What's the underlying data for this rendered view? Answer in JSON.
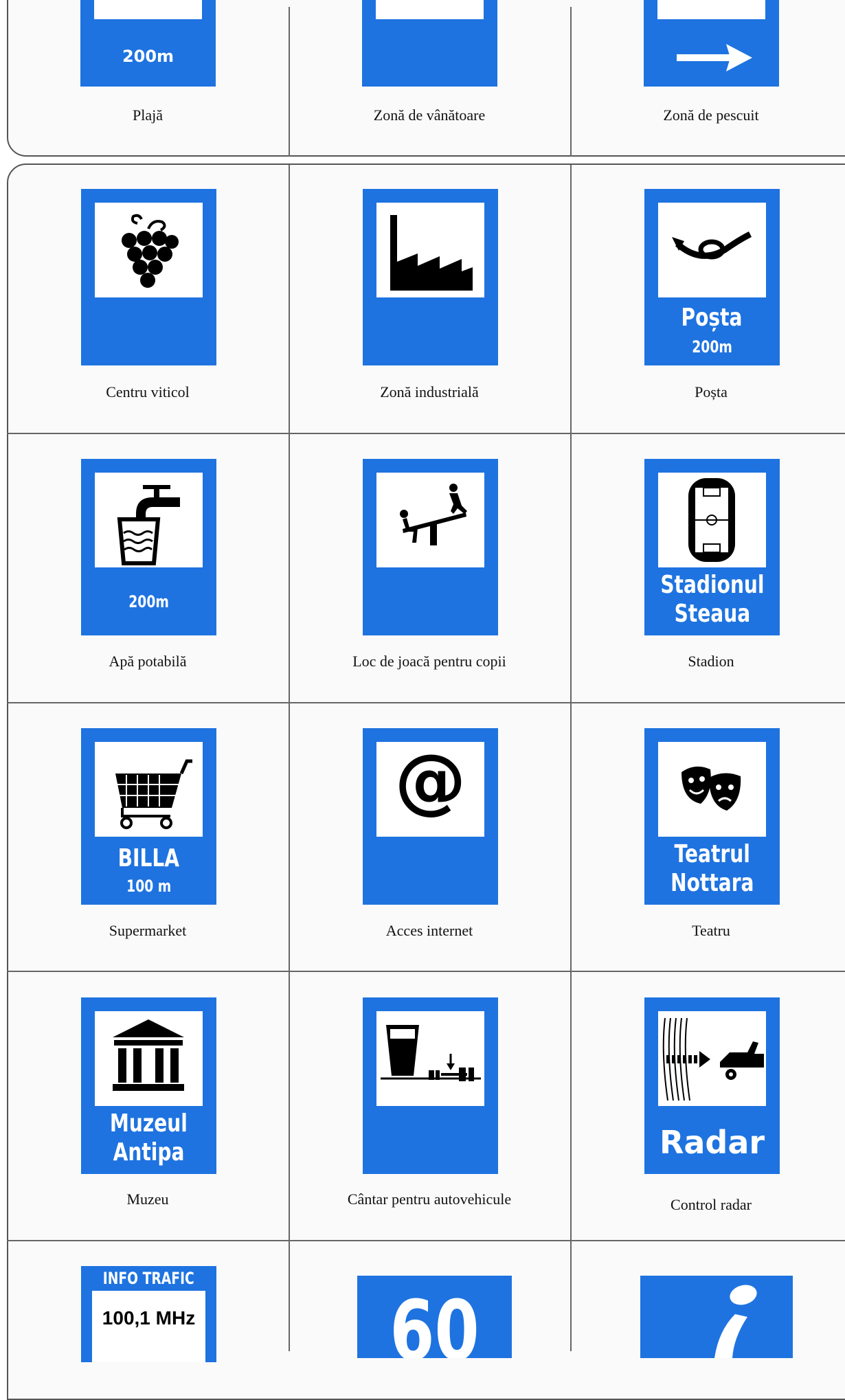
{
  "top_row": [
    {
      "caption": "Plajă",
      "distance": "200m"
    },
    {
      "caption": "Zonă de vânătoare"
    },
    {
      "caption": "Zonă de pescuit"
    }
  ],
  "rows": [
    [
      {
        "caption": "Centru viticol",
        "icon": "grapes-icon"
      },
      {
        "caption": "Zonă industrială",
        "icon": "factory-icon"
      },
      {
        "caption": "Poșta",
        "icon": "post-horn-icon",
        "sign_text": "Poșta",
        "distance": "200m"
      }
    ],
    [
      {
        "caption": "Apă potabilă",
        "icon": "water-tap-icon",
        "distance": "200m"
      },
      {
        "caption": "Loc de joacă pentru copii",
        "icon": "seesaw-icon"
      },
      {
        "caption": "Stadion",
        "icon": "stadium-icon",
        "sign_text_1": "Stadionul",
        "sign_text_2": "Steaua"
      }
    ],
    [
      {
        "caption": "Supermarket",
        "icon": "shopping-cart-icon",
        "sign_text": "BILLA",
        "distance": "100 m"
      },
      {
        "caption": "Acces internet",
        "icon": "at-sign-icon",
        "symbol": "@"
      },
      {
        "caption": "Teatru",
        "icon": "theater-masks-icon",
        "sign_text_1": "Teatrul",
        "sign_text_2": "Nottara"
      }
    ],
    [
      {
        "caption": "Muzeu",
        "icon": "museum-icon",
        "sign_text_1": "Muzeul",
        "sign_text_2": "Antipa"
      },
      {
        "caption": "Cântar pentru autovehicule",
        "icon": "vehicle-scale-icon"
      },
      {
        "caption": "Control radar",
        "icon": "radar-car-icon",
        "sign_text": "Radar"
      }
    ],
    [
      {
        "info_title": "INFO TRAFIC",
        "frequency": "100,1 MHz"
      },
      {
        "speed": "60"
      },
      {
        "icon": "info-i-icon"
      }
    ]
  ],
  "colors": {
    "sign_blue": "#1e73e0",
    "border": "#555555",
    "panel": "#fafafa"
  }
}
